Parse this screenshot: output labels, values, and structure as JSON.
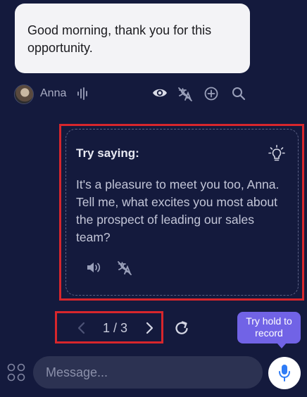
{
  "chat": {
    "incoming_message": "Good morning, thank you for this opportunity.",
    "sender_name": "Anna"
  },
  "message_actions": {
    "icons": [
      "audio-wave-icon",
      "eye-icon",
      "translate-off-icon",
      "add-circle-icon",
      "search-icon"
    ]
  },
  "suggestion": {
    "title": "Try saying:",
    "text": "It's a pleasure to meet you too, Anna. Tell me, what excites you most about the prospect of leading our sales team?",
    "icons": [
      "lightbulb-icon",
      "speaker-icon",
      "translate-off-icon"
    ]
  },
  "pager": {
    "label": "1 / 3",
    "current": 1,
    "total": 3
  },
  "tooltip": {
    "text": "Try hold to record"
  },
  "composer": {
    "placeholder": "Message...",
    "value": ""
  },
  "colors": {
    "background": "#141a3d",
    "bubble": "#f3f3f6",
    "highlight_outline": "#d7262c",
    "tooltip": "#7163e6",
    "accent_mic": "#2f7cf6",
    "input_background": "#2c3252"
  }
}
